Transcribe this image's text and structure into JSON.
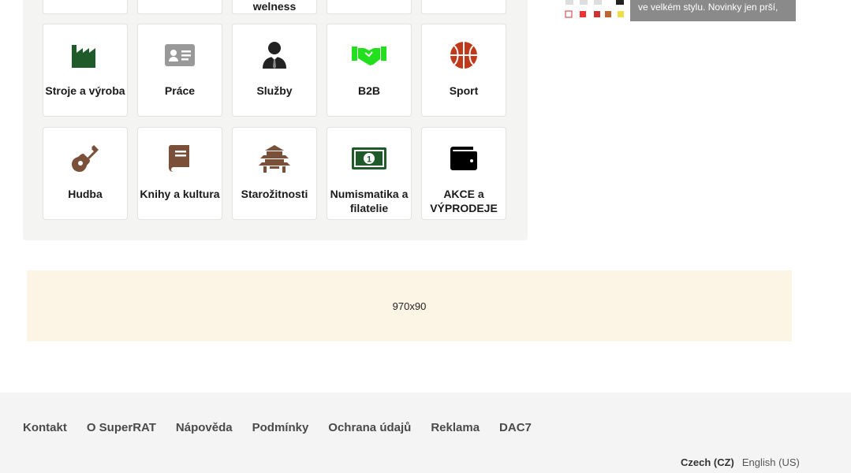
{
  "categories_top_row": [
    {
      "label": ""
    },
    {
      "label": ""
    },
    {
      "label": "welness"
    },
    {
      "label": ""
    },
    {
      "label": ""
    }
  ],
  "categories": [
    {
      "label": "Stroje a výroba",
      "icon": "factory-icon",
      "color": "#1e5a2a"
    },
    {
      "label": "Práce",
      "icon": "id-card-icon",
      "color": "#999999"
    },
    {
      "label": "Služby",
      "icon": "businessman-icon",
      "color": "#222222"
    },
    {
      "label": "B2B",
      "icon": "handshake-icon",
      "color": "#22e01e"
    },
    {
      "label": "Sport",
      "icon": "basketball-icon",
      "color": "#c0391b"
    },
    {
      "label": "Hudba",
      "icon": "guitar-icon",
      "color": "#7a5038"
    },
    {
      "label": "Knihy a kultura",
      "icon": "book-icon",
      "color": "#7a5038"
    },
    {
      "label": "Starožitnosti",
      "icon": "pagoda-icon",
      "color": "#7a5038"
    },
    {
      "label": "Numismatika a filatelie",
      "icon": "banknote-icon",
      "color": "#1e5a2a"
    },
    {
      "label": "AKCE a VÝPRODEJE",
      "icon": "wallet-icon",
      "color": "#000000"
    }
  ],
  "promo": {
    "text": "ve velkém stylu. Novinky jen prší,"
  },
  "ad": {
    "label": "970x90"
  },
  "footer": {
    "links": [
      "Kontakt",
      "O SuperRAT",
      "Nápověda",
      "Podmínky",
      "Ochrana údajů",
      "Reklama",
      "DAC7"
    ],
    "lang_active": "Czech (CZ)",
    "lang_other": "English (US)"
  }
}
